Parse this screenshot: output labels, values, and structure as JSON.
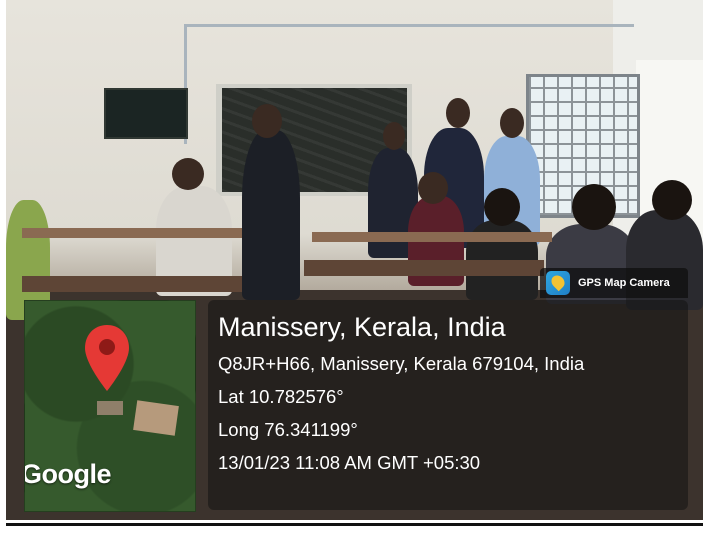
{
  "overlay": {
    "place": "Manissery, Kerala, India",
    "address": "Q8JR+H66, Manissery, Kerala 679104, India",
    "lat": "Lat 10.782576°",
    "long": "Long 76.341199°",
    "datetime": "13/01/23 11:08 AM GMT +05:30",
    "map_brand": "Google",
    "app_badge": "GPS Map Camera"
  },
  "icons": {
    "pin": "map-pin-icon",
    "app": "gps-map-camera-app-icon"
  },
  "colors": {
    "pin": "#e53935",
    "panel": "rgba(20,20,20,0.58)"
  }
}
